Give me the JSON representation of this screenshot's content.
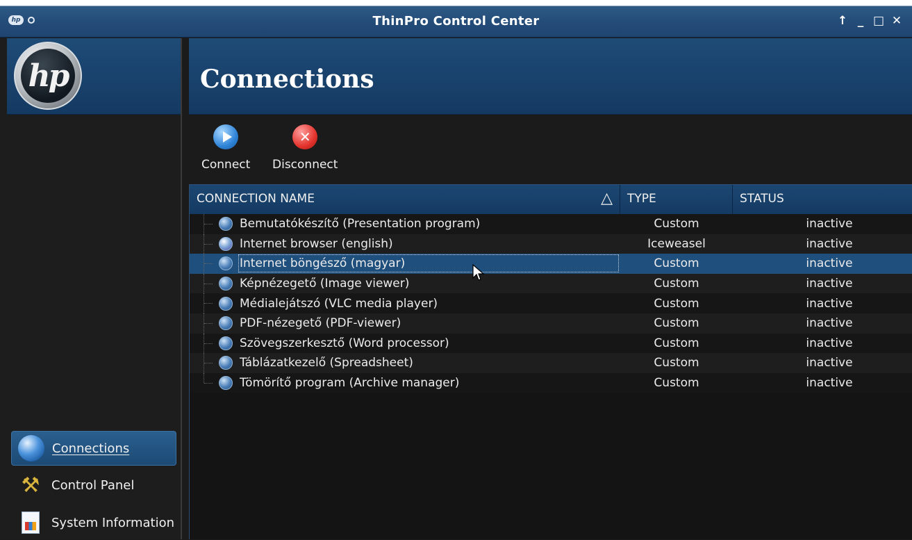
{
  "window": {
    "title": "ThinPro Control Center",
    "controls": [
      "↑",
      "_",
      "□",
      "✕"
    ],
    "left_badge": "hp"
  },
  "sidebar": {
    "logo_text": "hp",
    "items": [
      {
        "label": "Connections",
        "icon": "globe-icon",
        "active": true
      },
      {
        "label": "Control Panel",
        "icon": "tools-icon",
        "active": false
      },
      {
        "label": "System Information",
        "icon": "system-info-icon",
        "active": false
      }
    ]
  },
  "main": {
    "title": "Connections",
    "toolbar": {
      "connect_label": "Connect",
      "disconnect_label": "Disconnect"
    },
    "table": {
      "columns": {
        "name": "CONNECTION NAME",
        "sort_indicator": "△",
        "type": "TYPE",
        "status": "STATUS"
      },
      "rows": [
        {
          "name": "Bemutatókészítő (Presentation program)",
          "type": "Custom",
          "status": "inactive"
        },
        {
          "name": "Internet browser (english)",
          "type": "Iceweasel",
          "status": "inactive"
        },
        {
          "name": "Internet böngésző (magyar)",
          "type": "Custom",
          "status": "inactive"
        },
        {
          "name": "Képnézegető (Image viewer)",
          "type": "Custom",
          "status": "inactive"
        },
        {
          "name": "Médialejátszó (VLC media player)",
          "type": "Custom",
          "status": "inactive"
        },
        {
          "name": "PDF-nézegető (PDF-viewer)",
          "type": "Custom",
          "status": "inactive"
        },
        {
          "name": "Szövegszerkesztő (Word processor)",
          "type": "Custom",
          "status": "inactive"
        },
        {
          "name": "Táblázatkezelő (Spreadsheet)",
          "type": "Custom",
          "status": "inactive"
        },
        {
          "name": "Tömörítő program (Archive manager)",
          "type": "Custom",
          "status": "inactive"
        }
      ]
    }
  },
  "colors": {
    "accent_blue": "#1e4b77",
    "selected_row": "#1f4f7d",
    "background": "#1b1b1b"
  }
}
